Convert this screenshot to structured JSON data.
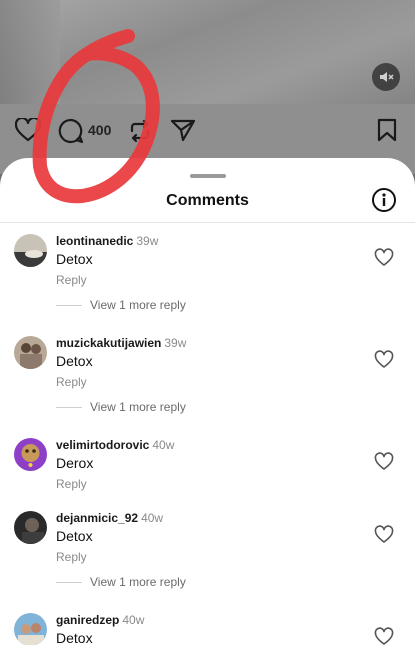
{
  "post": {
    "comment_count": "400"
  },
  "sheet": {
    "title": "Comments"
  },
  "comments": [
    {
      "username": "leontinanedic",
      "time": "39w",
      "text": "Detox",
      "reply_label": "Reply",
      "more_replies": "View 1 more reply"
    },
    {
      "username": "muzickakutijawien",
      "time": "39w",
      "text": "Detox",
      "reply_label": "Reply",
      "more_replies": "View 1 more reply"
    },
    {
      "username": "velimirtodorovic",
      "time": "40w",
      "text": "Derox",
      "reply_label": "Reply"
    },
    {
      "username": "dejanmicic_92",
      "time": "40w",
      "text": "Detox",
      "reply_label": "Reply",
      "more_replies": "View 1 more reply"
    },
    {
      "username": "ganiredzep",
      "time": "40w",
      "text": "Detox"
    }
  ],
  "colors": {
    "scribble": "#e8383b",
    "sheet_bg": "#ffffff",
    "overlay": "#8f8f8f"
  }
}
